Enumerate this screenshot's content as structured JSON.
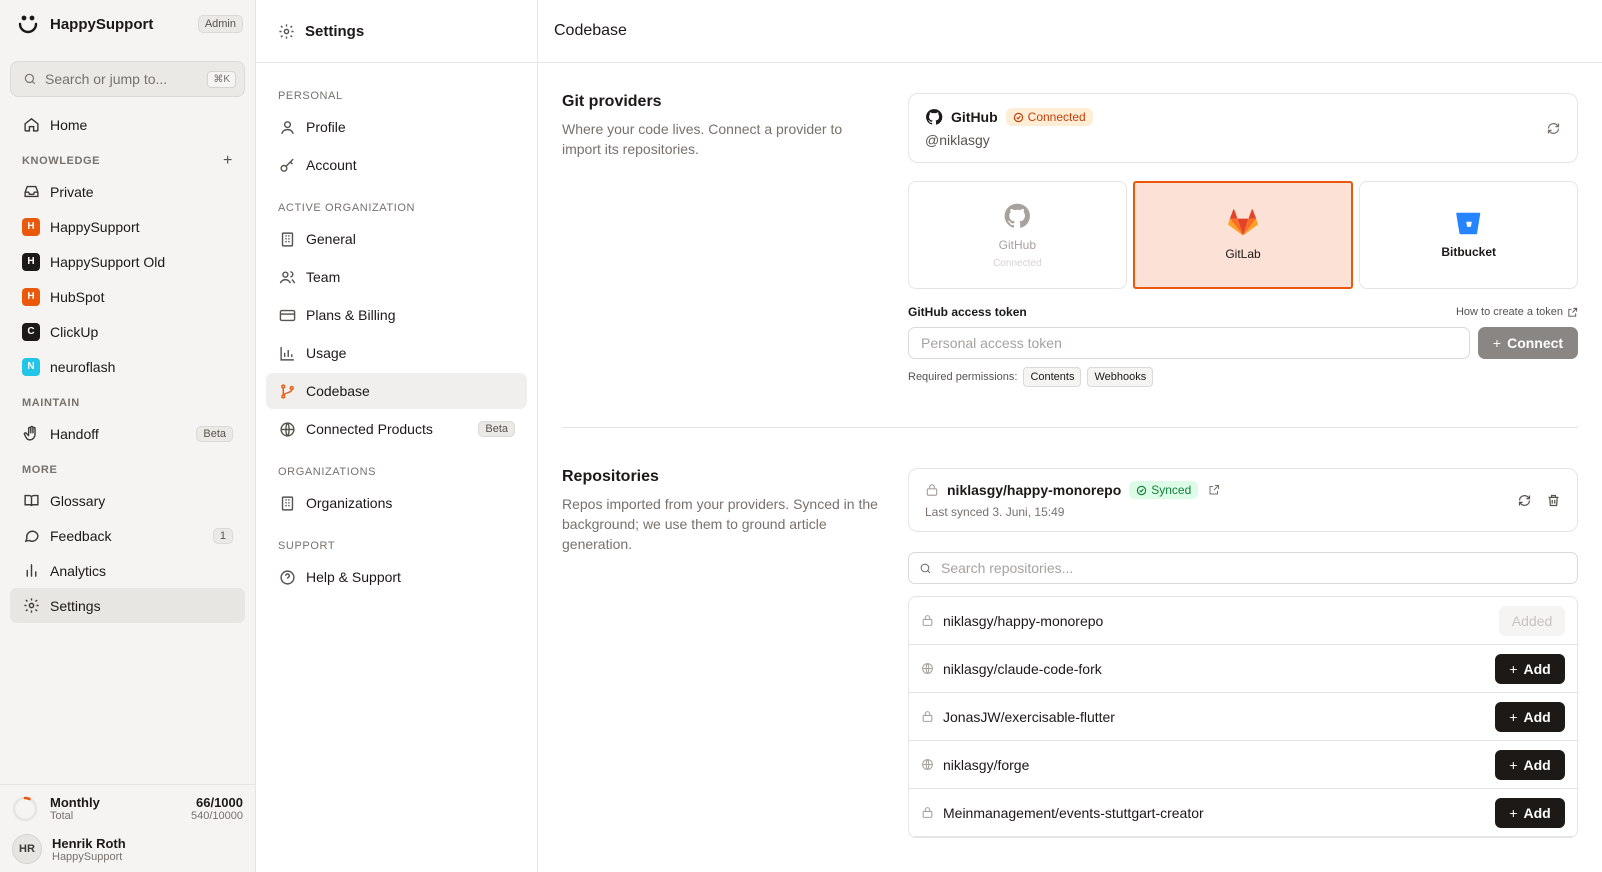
{
  "brand": {
    "name": "HappySupport",
    "role": "Admin"
  },
  "search": {
    "placeholder": "Search or jump to...",
    "shortcut": "⌘K"
  },
  "sidebar": {
    "home": "Home",
    "knowledge_label": "KNOWLEDGE",
    "knowledge": [
      {
        "label": "Private"
      },
      {
        "label": "HappySupport",
        "letter": "H",
        "color": "#ea580c"
      },
      {
        "label": "HappySupport Old",
        "letter": "H",
        "color": "#1c1917"
      },
      {
        "label": "HubSpot",
        "letter": "H",
        "color": "#ea580c"
      },
      {
        "label": "ClickUp",
        "letter": "C",
        "color": "#1c1917"
      },
      {
        "label": "neuroflash",
        "letter": "N",
        "color": "#22c5e8"
      }
    ],
    "maintain_label": "MAINTAIN",
    "handoff": "Handoff",
    "handoff_badge": "Beta",
    "more_label": "MORE",
    "glossary": "Glossary",
    "feedback": "Feedback",
    "feedback_count": "1",
    "analytics": "Analytics",
    "settings": "Settings"
  },
  "usage": {
    "label": "Monthly",
    "sub": "Total",
    "value": "66/1000",
    "sub_value": "540/10000",
    "fraction": 0.066
  },
  "user": {
    "initials": "HR",
    "name": "Henrik Roth",
    "org": "HappySupport"
  },
  "settings": {
    "title": "Settings",
    "personal_label": "PERSONAL",
    "profile": "Profile",
    "account": "Account",
    "active_org_label": "ACTIVE ORGANIZATION",
    "general": "General",
    "team": "Team",
    "billing": "Plans & Billing",
    "usage": "Usage",
    "codebase": "Codebase",
    "connected_products": "Connected Products",
    "connected_badge": "Beta",
    "orgs_label": "ORGANIZATIONS",
    "organizations": "Organizations",
    "support_label": "SUPPORT",
    "help": "Help & Support"
  },
  "main": {
    "title": "Codebase",
    "git": {
      "heading": "Git providers",
      "desc": "Where your code lives. Connect a provider to import its repositories.",
      "connected_name": "GitHub",
      "connected_status": "Connected",
      "connected_user": "@niklasgy",
      "providers": [
        {
          "name": "GitHub",
          "sub": "Connected"
        },
        {
          "name": "GitLab"
        },
        {
          "name": "Bitbucket"
        }
      ],
      "token_label": "GitHub access token",
      "token_help": "How to create a token",
      "token_placeholder": "Personal access token",
      "connect_label": "Connect",
      "perm_label": "Required permissions:",
      "perms": [
        "Contents",
        "Webhooks"
      ]
    },
    "repos": {
      "heading": "Repositories",
      "desc": "Repos imported from your providers. Synced in the background; we use them to ground article generation.",
      "synced_name": "niklasgy/happy-monorepo",
      "synced_status": "Synced",
      "synced_time": "Last synced 3. Juni, 15:49",
      "search_placeholder": "Search repositories...",
      "list": [
        {
          "name": "niklasgy/happy-monorepo",
          "icon": "lock-icon",
          "action": "Added"
        },
        {
          "name": "niklasgy/claude-code-fork",
          "icon": "globe-icon",
          "action": "Add"
        },
        {
          "name": "JonasJW/exercisable-flutter",
          "icon": "lock-icon",
          "action": "Add"
        },
        {
          "name": "niklasgy/forge",
          "icon": "globe-icon",
          "action": "Add"
        },
        {
          "name": "Meinmanagement/events-stuttgart-creator",
          "icon": "lock-icon",
          "action": "Add"
        }
      ]
    }
  }
}
